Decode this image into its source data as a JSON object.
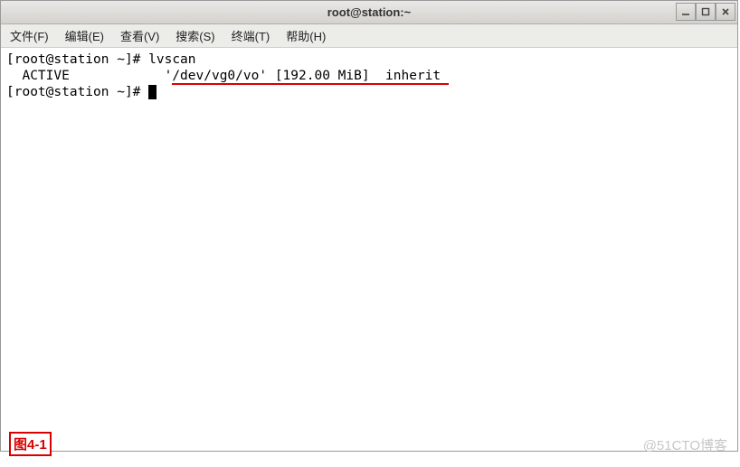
{
  "titlebar": {
    "title": "root@station:~"
  },
  "menu": {
    "file": "文件(F)",
    "edit": "编辑(E)",
    "view": "查看(V)",
    "search": "搜索(S)",
    "terminal": "终端(T)",
    "help": "帮助(H)"
  },
  "term": {
    "line1_prompt": "[root@station ~]# ",
    "line1_cmd": "lvscan",
    "line2_a": "  ACTIVE            '",
    "line2_b": "/dev/vg0/vo' [192.00 MiB]  inherit ",
    "line3_prompt": "[root@station ~]# "
  },
  "caption": "图4-1",
  "watermark": "@51CTO博客"
}
